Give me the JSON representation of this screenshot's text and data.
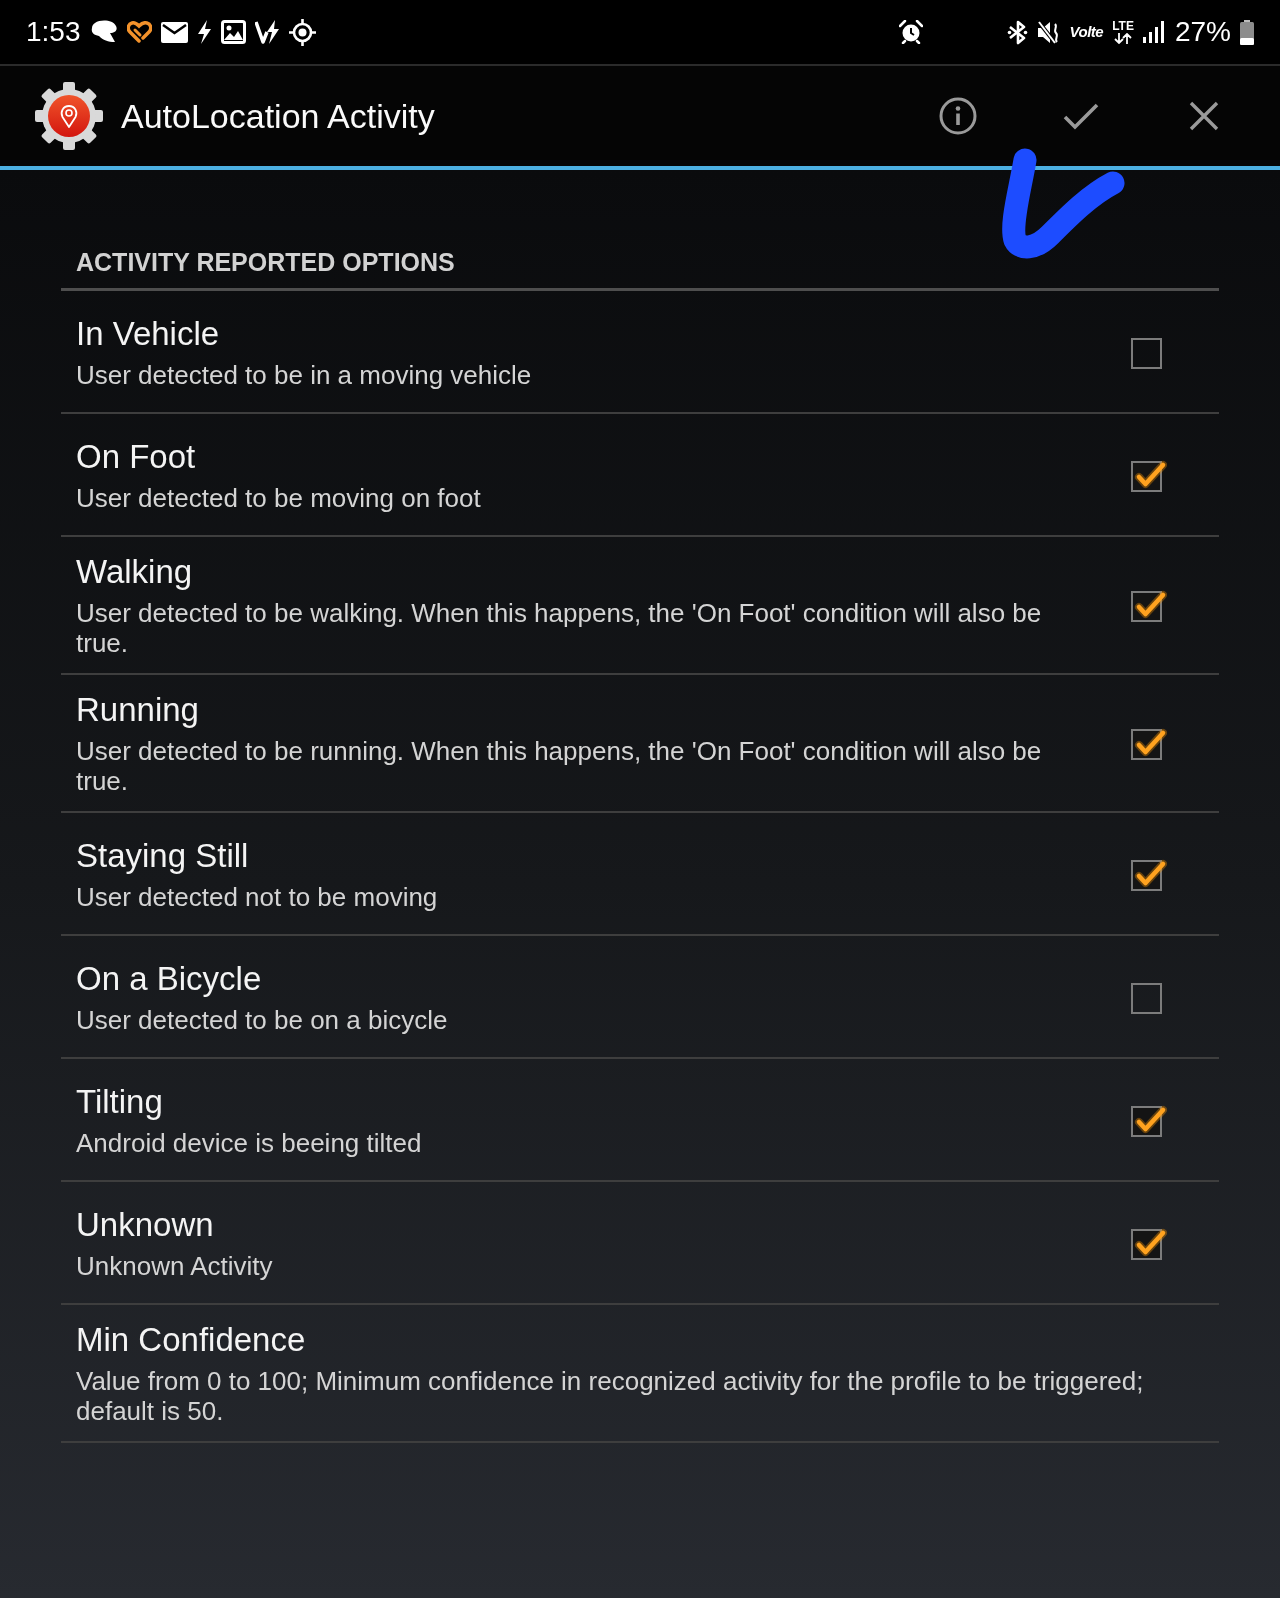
{
  "status_bar": {
    "time": "1:53",
    "volte_label": "Volte",
    "network_label": "LTE",
    "battery": "27%"
  },
  "header": {
    "title": "AutoLocation Activity"
  },
  "section": {
    "heading": "ACTIVITY REPORTED OPTIONS",
    "options": [
      {
        "kind": "checkbox",
        "title": "In Vehicle",
        "description": "User detected to be in a moving vehicle",
        "checked": false
      },
      {
        "kind": "checkbox",
        "title": "On Foot",
        "description": "User detected to be moving on foot",
        "checked": true
      },
      {
        "kind": "checkbox",
        "title": "Walking",
        "description": "User detected to be walking. When this happens, the 'On Foot' condition will also be true.",
        "checked": true
      },
      {
        "kind": "checkbox",
        "title": "Running",
        "description": "User detected to be running. When this happens, the 'On Foot' condition will also be true.",
        "checked": true
      },
      {
        "kind": "checkbox",
        "title": "Staying Still",
        "description": "User detected not to be moving",
        "checked": true
      },
      {
        "kind": "checkbox",
        "title": "On a Bicycle",
        "description": "User detected to be on a bicycle",
        "checked": false
      },
      {
        "kind": "checkbox",
        "title": "Tilting",
        "description": "Android device is beeing tilted",
        "checked": true
      },
      {
        "kind": "checkbox",
        "title": "Unknown",
        "description": "Unknown Activity",
        "checked": true
      },
      {
        "kind": "text",
        "title": "Min Confidence",
        "description": "Value from 0 to 100; Minimum confidence in recognized activity for the profile to be triggered; default is 50."
      }
    ]
  }
}
